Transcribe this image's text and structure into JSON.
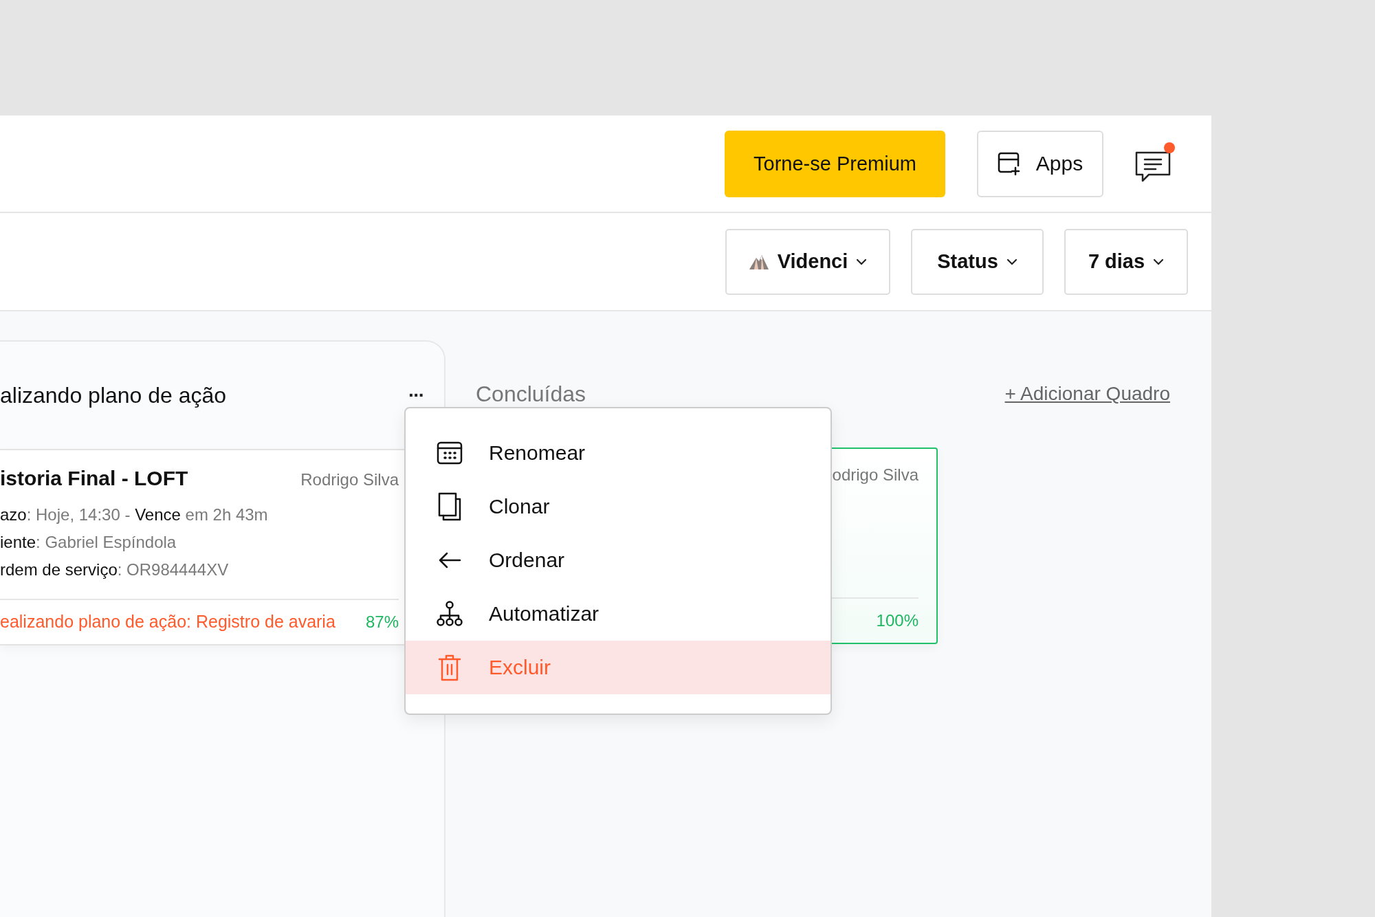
{
  "header": {
    "premium_button": "Torne-se Premium",
    "apps_button": "Apps",
    "chat": {
      "unread": true
    }
  },
  "filters": [
    {
      "label": "Videnci",
      "kind": "workspace"
    },
    {
      "label": "Status",
      "kind": "plain"
    },
    {
      "label": "7 dias",
      "kind": "plain"
    }
  ],
  "columns": [
    {
      "title": "alizando plano de ação",
      "menu_button": "···",
      "cards": [
        {
          "title": "istoria Final - LOFT",
          "assignee": "Rodrigo Silva",
          "lines": [
            [
              {
                "text": "azo",
                "strong": true
              },
              {
                "text": ": Hoje, 14:30 - ",
                "strong": false
              },
              {
                "text": "Vence",
                "strong": true
              },
              {
                "text": " em 2h 43m",
                "strong": false
              }
            ],
            [
              {
                "text": "iente",
                "strong": true
              },
              {
                "text": ": Gabriel Espíndola",
                "strong": false
              }
            ],
            [
              {
                "text": "rdem de serviço",
                "strong": true
              },
              {
                "text": ": OR984444XV",
                "strong": false
              }
            ]
          ],
          "stage": "ealizando plano de ação: Registro de avaria",
          "progress": "87%",
          "complete": false
        }
      ]
    },
    {
      "title": "Concluídas",
      "cards": [
        {
          "assignee": "odrigo Silva",
          "progress": "100%",
          "complete": true
        }
      ]
    }
  ],
  "add_board_link": "+ Adicionar Quadro",
  "context_menu": [
    {
      "label": "Renomear",
      "kind": "normal",
      "selected": false
    },
    {
      "label": "Clonar",
      "kind": "normal",
      "selected": false
    },
    {
      "label": "Ordenar",
      "kind": "normal",
      "selected": false
    },
    {
      "label": "Automatizar",
      "kind": "normal",
      "selected": false
    },
    {
      "label": "Excluir",
      "kind": "danger",
      "selected": true
    }
  ]
}
